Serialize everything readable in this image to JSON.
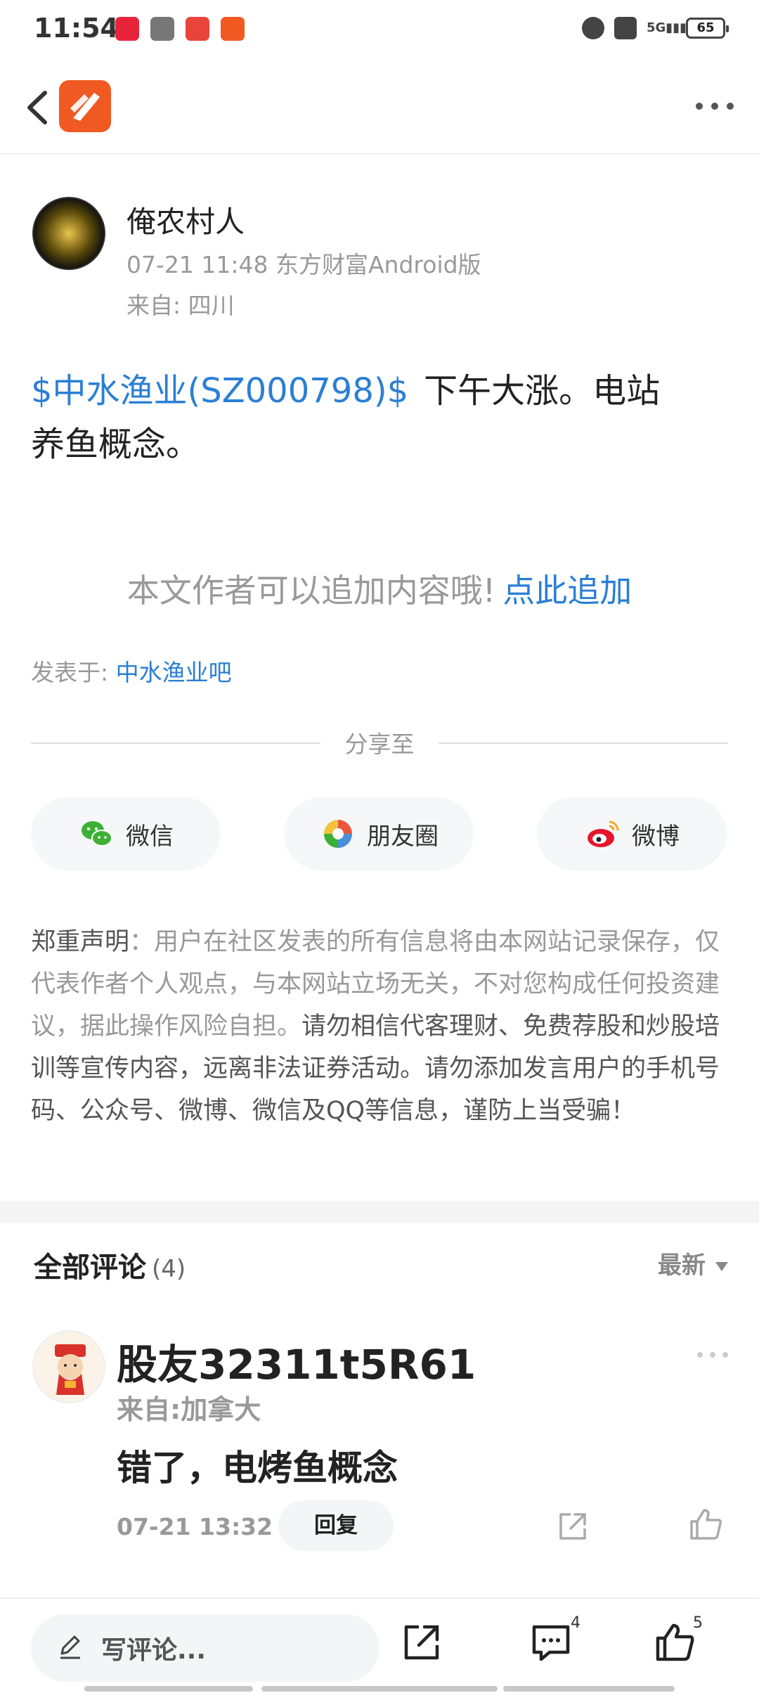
{
  "status_bar": {
    "time": "11:54",
    "battery": "65"
  },
  "post": {
    "author_name": "俺农村人",
    "meta": "07-21 11:48 东方财富Android版",
    "location": "来自: 四川",
    "stock_tag": "$中水渔业(SZ000798)$",
    "text_part1": "下午大涨。电站",
    "text_part2": "养鱼概念。",
    "append_hint": "本文作者可以追加内容哦!",
    "append_link": "点此追加",
    "posted_in_label": "发表于:",
    "posted_in_bar": "中水渔业吧"
  },
  "share": {
    "label": "分享至",
    "wechat": "微信",
    "moments": "朋友圈",
    "weibo": "微博"
  },
  "disclaimer": {
    "title": "郑重声明",
    "body1": "：用户在社区发表的所有信息将由本网站记录保存，仅代表作者个人观点，与本网站立场无关，不对您构成任何投资建议，据此操作风险自担。",
    "body2": "请勿相信代客理财、免费荐股和炒股培训等宣传内容，远离非法证券活动。请勿添加发言用户的手机号码、公众号、微博、微信及QQ等信息，谨防上当受骗！"
  },
  "comments": {
    "title": "全部评论",
    "count": "(4)",
    "sort": "最新",
    "items": [
      {
        "user": "股友32311t5R61",
        "location": "来自:加拿大",
        "text": "错了，电烤鱼概念",
        "time": "07-21 13:32",
        "reply_label": "回复"
      }
    ]
  },
  "bottom_bar": {
    "write_placeholder": "写评论...",
    "comment_count": "4",
    "like_count": "5"
  },
  "colors": {
    "link_blue": "#2a7fd4",
    "brand_orange": "#f05a22"
  }
}
